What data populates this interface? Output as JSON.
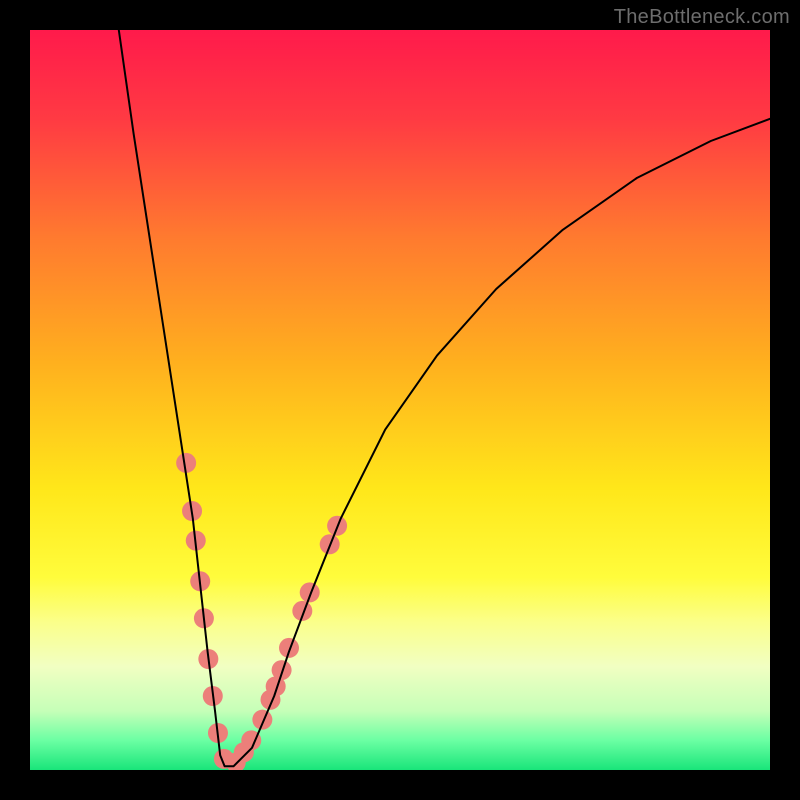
{
  "watermark": "TheBottleneck.com",
  "chart_data": {
    "type": "line",
    "title": "",
    "xlabel": "",
    "ylabel": "",
    "xlim": [
      0,
      100
    ],
    "ylim": [
      0,
      100
    ],
    "grid": false,
    "legend": false,
    "background_gradient": {
      "stops": [
        {
          "offset": 0.0,
          "color": "#ff1a4b"
        },
        {
          "offset": 0.12,
          "color": "#ff3a43"
        },
        {
          "offset": 0.28,
          "color": "#ff7a2f"
        },
        {
          "offset": 0.45,
          "color": "#ffb01e"
        },
        {
          "offset": 0.62,
          "color": "#ffe71a"
        },
        {
          "offset": 0.74,
          "color": "#fffc3c"
        },
        {
          "offset": 0.8,
          "color": "#fbff8a"
        },
        {
          "offset": 0.86,
          "color": "#f1ffc2"
        },
        {
          "offset": 0.92,
          "color": "#c6ffb8"
        },
        {
          "offset": 0.96,
          "color": "#6bffa3"
        },
        {
          "offset": 1.0,
          "color": "#19e57a"
        }
      ]
    },
    "series": [
      {
        "name": "bottleneck-curve",
        "x": [
          12,
          14,
          16,
          18,
          20,
          22,
          23,
          24,
          25,
          25.7,
          26.3,
          27.5,
          30,
          33,
          35,
          38,
          42,
          48,
          55,
          63,
          72,
          82,
          92,
          100
        ],
        "y": [
          100,
          86,
          73,
          60,
          47,
          34,
          25,
          16,
          8,
          2,
          0.5,
          0.5,
          3,
          10,
          16,
          24,
          34,
          46,
          56,
          65,
          73,
          80,
          85,
          88
        ],
        "stroke": "#000000",
        "stroke_width": 2
      }
    ],
    "markers": {
      "color": "#ec7f7a",
      "radius": 10,
      "points_xy": [
        [
          21.1,
          41.5
        ],
        [
          21.9,
          35.0
        ],
        [
          22.4,
          31.0
        ],
        [
          23.0,
          25.5
        ],
        [
          23.5,
          20.5
        ],
        [
          24.1,
          15.0
        ],
        [
          24.7,
          10.0
        ],
        [
          25.4,
          5.0
        ],
        [
          26.2,
          1.5
        ],
        [
          27.8,
          1.0
        ],
        [
          28.9,
          2.4
        ],
        [
          29.9,
          4.0
        ],
        [
          31.4,
          6.8
        ],
        [
          32.5,
          9.5
        ],
        [
          33.2,
          11.3
        ],
        [
          34.0,
          13.5
        ],
        [
          35.0,
          16.5
        ],
        [
          36.8,
          21.5
        ],
        [
          37.8,
          24.0
        ],
        [
          40.5,
          30.5
        ],
        [
          41.5,
          33.0
        ]
      ]
    }
  }
}
